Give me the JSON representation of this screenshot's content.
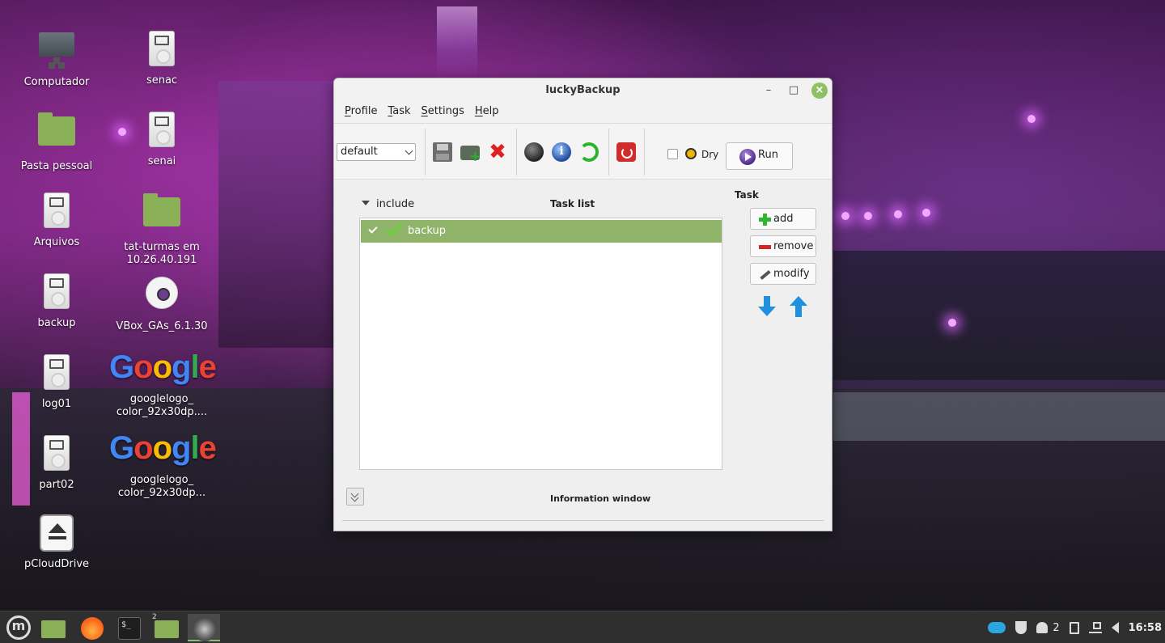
{
  "desktop": {
    "icons": [
      {
        "label": "Computador",
        "type": "computer"
      },
      {
        "label": "senac",
        "type": "drive"
      },
      {
        "label": "Pasta pessoal",
        "type": "home-folder"
      },
      {
        "label": "senai",
        "type": "drive"
      },
      {
        "label": "Arquivos",
        "type": "drive"
      },
      {
        "label": "tat-turmas em 10.26.40.191",
        "type": "network-folder"
      },
      {
        "label": "backup",
        "type": "drive"
      },
      {
        "label": "VBox_GAs_6.1.30",
        "type": "disc"
      },
      {
        "label": "log01",
        "type": "drive"
      },
      {
        "label": "googlelogo_ color_92x30dp....",
        "type": "image"
      },
      {
        "label": "part02",
        "type": "drive"
      },
      {
        "label": "googlelogo_ color_92x30dp...",
        "type": "image"
      },
      {
        "label": "pCloudDrive",
        "type": "eject-drive"
      }
    ],
    "google_logo_text": "Google"
  },
  "window": {
    "title": "luckyBackup",
    "menu": [
      "Profile",
      "Task",
      "Settings",
      "Help"
    ],
    "toolbar": {
      "profile_value": "default",
      "dry_label": "Dry",
      "dry_checked": false,
      "run_label": "Run"
    },
    "include_label": "include",
    "tasklist_label": "Task list",
    "tasks": [
      {
        "name": "backup",
        "checked": true,
        "selected": true
      }
    ],
    "task_panel": {
      "header": "Task",
      "add_label": "add",
      "remove_label": "remove",
      "modify_label": "modify"
    },
    "info_label": "Information window"
  },
  "taskbar": {
    "workspace_badge": "2",
    "tray_count": "2",
    "clock": "16:58"
  },
  "colors": {
    "accent": "#8fc066",
    "selected_row": "#8fb46a",
    "taskbar": "#2f2f2f"
  }
}
